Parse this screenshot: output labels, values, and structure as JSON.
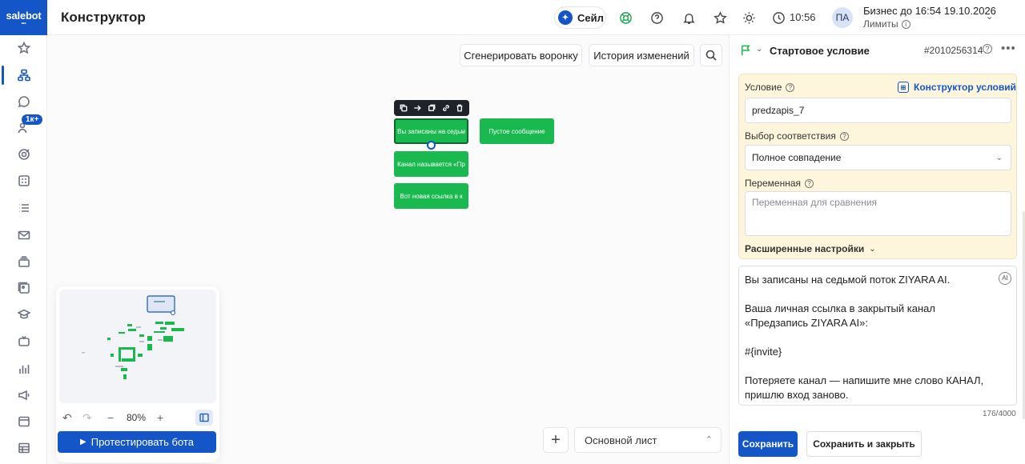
{
  "brand": {
    "logo": "salebot",
    "accent": "#1456c8",
    "node_green": "#19b94f"
  },
  "nav": {
    "items": [
      {
        "icon": "star-icon"
      },
      {
        "icon": "sitemap-icon",
        "active": true
      },
      {
        "icon": "chat-icon"
      },
      {
        "icon": "users-icon",
        "badge": "1к+"
      },
      {
        "icon": "target-icon"
      },
      {
        "icon": "grid-icon"
      },
      {
        "icon": "list-icon"
      },
      {
        "icon": "mail-icon"
      },
      {
        "icon": "layers-icon"
      },
      {
        "icon": "image-stack-icon"
      },
      {
        "icon": "graduation-icon"
      },
      {
        "icon": "tv-icon"
      },
      {
        "icon": "bar-chart-icon"
      },
      {
        "icon": "megaphone-icon"
      },
      {
        "icon": "browser-icon"
      },
      {
        "icon": "table-icon"
      }
    ]
  },
  "topbar": {
    "title": "Конструктор",
    "sale_label": "Сейл",
    "time": "10:56",
    "avatar": "ПА",
    "plan": "Бизнес до 16:54 19.10.2026",
    "limits": "Лимиты"
  },
  "canvas": {
    "generate_label": "Сгенерировать воронку",
    "history_label": "История изменений",
    "nodes": [
      {
        "text": "Вы записаны на седьм"
      },
      {
        "text": "Пустое сообщение"
      },
      {
        "text": "Канал называется «Пр"
      },
      {
        "text": "Вот новая ссылка в к"
      }
    ],
    "zoom": "80%",
    "test_label": "Протестировать бота",
    "sheet": "Основной лист"
  },
  "panel": {
    "title": "Стартовое условие",
    "id": "#2010256314",
    "condition_label": "Условие",
    "condition_builder": "Конструктор условий",
    "condition_value": "predzapis_7",
    "match_label": "Выбор соответствия",
    "match_value": "Полное совпадение",
    "variable_label": "Переменная",
    "variable_placeholder": "Переменная для сравнения",
    "advanced_label": "Расширенные настройки",
    "message_lines": [
      "Вы записаны на седьмой поток ZIYARA AI.",
      "",
      "Ваша личная ссылка в закрытый канал",
      "«Предзапись ZIYARA AI»:",
      "",
      "#{invite}",
      "",
      "Потеряете канал — напишите мне слово КАНАЛ,",
      "пришлю вход заново."
    ],
    "counter": "176/4000",
    "save_label": "Сохранить",
    "save_close_label": "Сохранить и закрыть"
  }
}
